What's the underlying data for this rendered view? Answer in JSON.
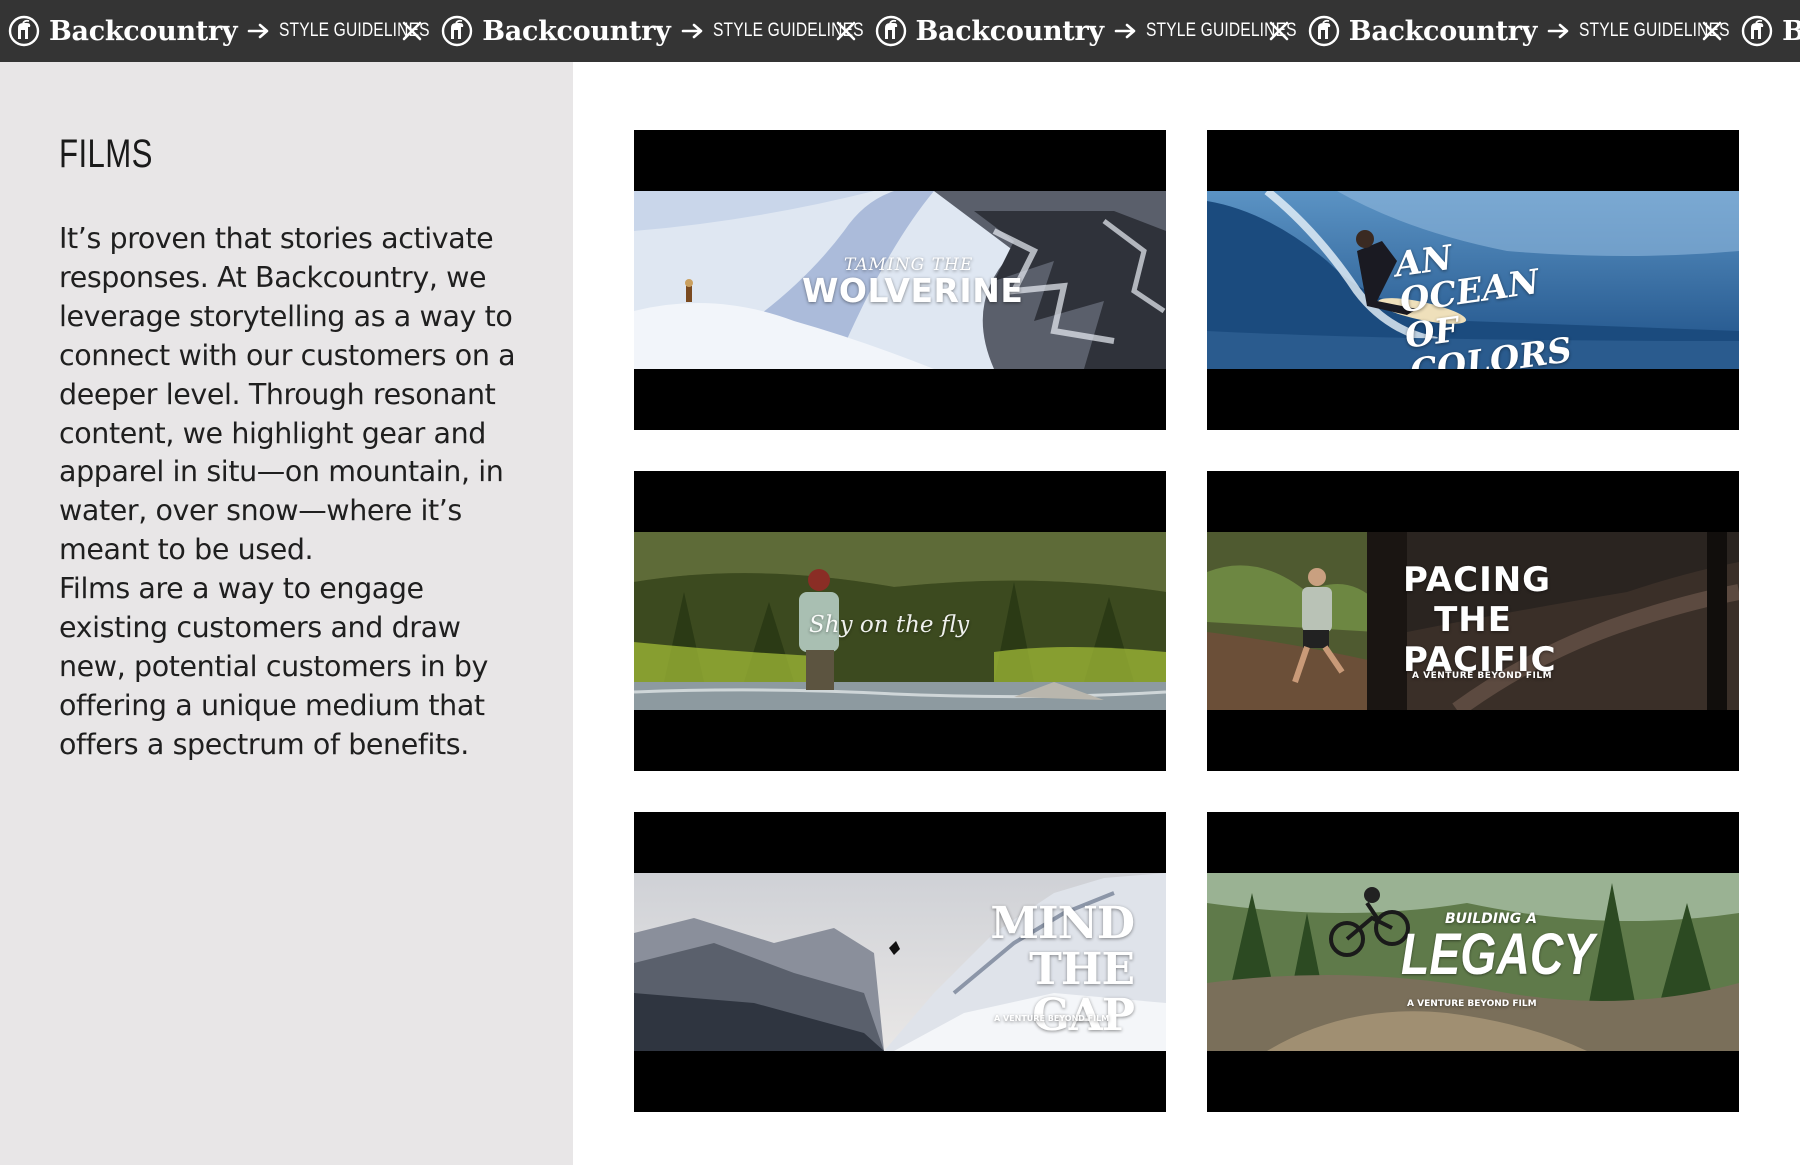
{
  "banner": {
    "brand": "Backcountry",
    "section": "STYLE GUIDELINES",
    "repeat_count": 5,
    "background": "#343434",
    "text_color": "#ffffff",
    "icons": [
      "backcountry-goat-logo-icon",
      "arrow-right-icon",
      "x-icon"
    ]
  },
  "left_panel": {
    "background": "#e8e6e7",
    "title": "FILMS",
    "paragraph_1": "It’s proven that stories activate responses. At Backcountry, we leverage storytelling as a way to connect with our customers on a deeper level. Through resonant content, we highlight gear and apparel in situ—on mountain, in water, over snow—where it’s meant to be used.",
    "paragraph_2": "Films are a way to engage existing customers and draw new, potential customers in by offering a unique medium that offers a spectrum of benefits."
  },
  "films": [
    {
      "kicker": "TAMING THE",
      "title": "WOLVERINE",
      "subtitle": ""
    },
    {
      "kicker": "",
      "title": "AN OCEAN OF COLORS",
      "subtitle": ""
    },
    {
      "kicker": "",
      "title": "Shy on the fly",
      "subtitle": ""
    },
    {
      "kicker": "",
      "title": "PACING THE PACIFIC",
      "subtitle": "A VENTURE BEYOND FILM"
    },
    {
      "kicker": "",
      "title": "MIND THE GAP",
      "subtitle": "A VENTURE BEYOND FILM"
    },
    {
      "kicker": "BUILDING A",
      "title": "LEGACY",
      "subtitle": "A VENTURE BEYOND FILM"
    }
  ]
}
